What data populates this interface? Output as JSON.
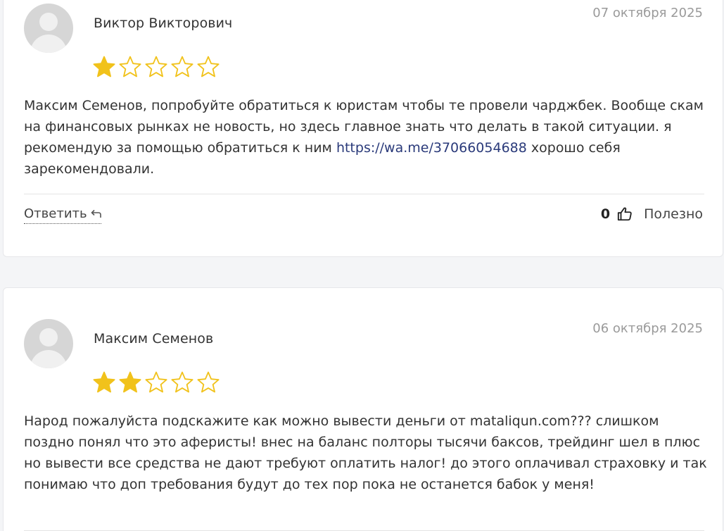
{
  "colors": {
    "star_filled": "#f1c21b",
    "star_empty_stroke": "#f1c21b",
    "link": "#2a3a7a",
    "date": "#9a9a9a"
  },
  "reviews": [
    {
      "author": "Виктор Викторович",
      "date": "07 октября 2025",
      "rating": 1,
      "max_rating": 5,
      "text_before_link": "Максим Семенов, попробуйте обратиться к юристам чтобы те провели чарджбек. Вообще скам на финансовых рынках не новость, но здесь главное знать что делать в такой ситуации. я рекомендую за помощью обратиться к ним ",
      "link_text": "https://wa.me/37066054688",
      "text_after_link": " хорошо себя зарекомендовали.",
      "reply_label": "Ответить",
      "reply_icon": "reply-arrow-icon",
      "likes": "0",
      "helpful_label": "Полезно",
      "like_icon": "thumbs-up-icon"
    },
    {
      "author": "Максим Семенов",
      "date": "06 октября 2025",
      "rating": 2,
      "max_rating": 5,
      "text": "Народ пожалуйста подскажите как можно вывести деньги от mataliqun.com??? слишком поздно понял что это аферисты! внес на баланс полторы тысячи баксов, трейдинг шел в плюс но вывести все средства не дают требуют оплатить налог! до этого оплачивал страховку и так понимаю что доп требования будут до тех пор пока не останется бабок у меня!"
    }
  ]
}
